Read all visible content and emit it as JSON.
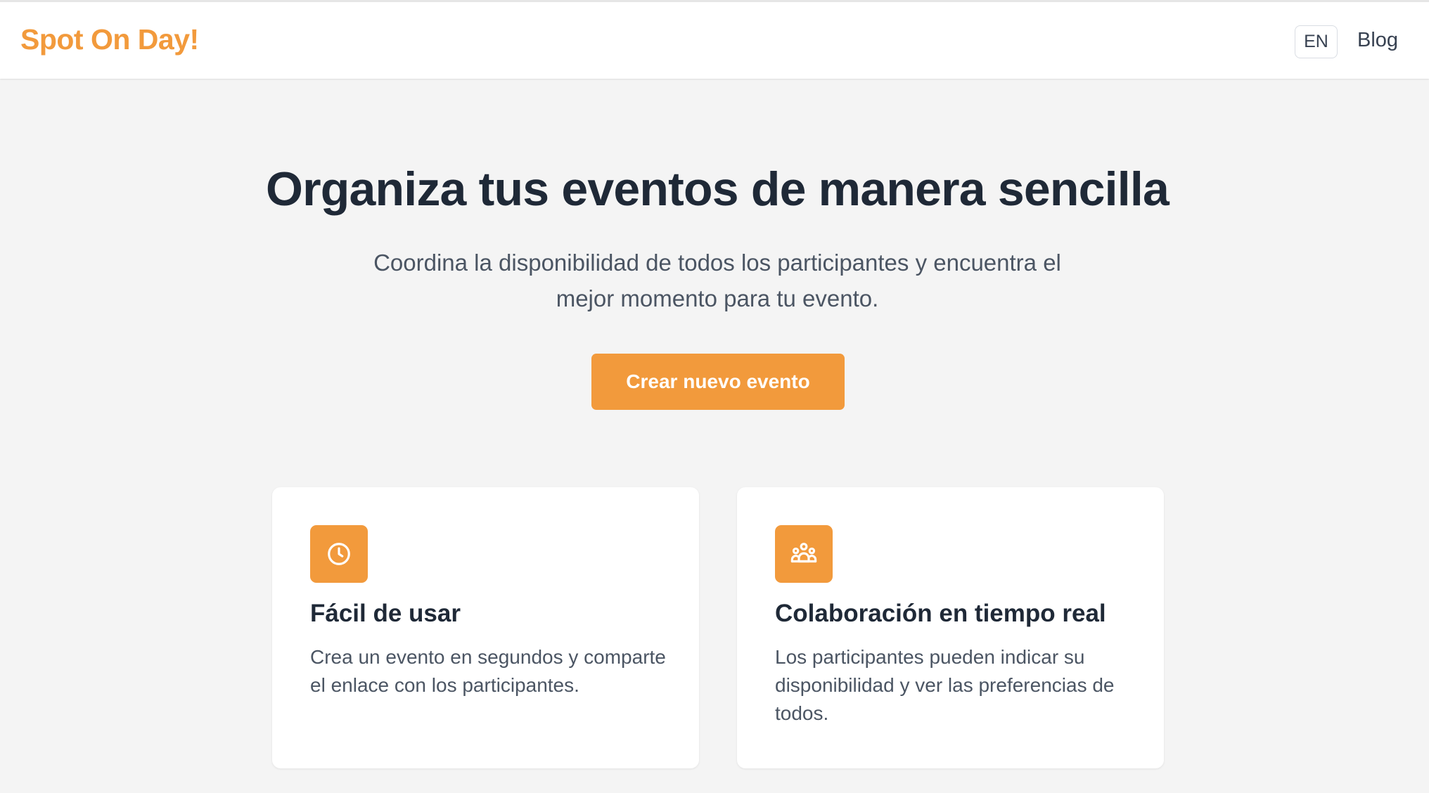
{
  "header": {
    "brand": "Spot On Day!",
    "language_button": "EN",
    "blog_link": "Blog"
  },
  "hero": {
    "title": "Organiza tus eventos de manera sencilla",
    "subtitle": "Coordina la disponibilidad de todos los participantes y encuentra el mejor momento para tu evento.",
    "cta_label": "Crear nuevo evento"
  },
  "features": [
    {
      "icon": "clock-icon",
      "title": "Fácil de usar",
      "description": "Crea un evento en segundos y comparte el enlace con los participantes."
    },
    {
      "icon": "users-group-icon",
      "title": "Colaboración en tiempo real",
      "description": "Los participantes pueden indicar su disponibilidad y ver las preferencias de todos."
    }
  ],
  "colors": {
    "accent": "#f29a3c",
    "background": "#f4f4f4",
    "text_primary": "#1f2937",
    "text_secondary": "#4b5563"
  }
}
